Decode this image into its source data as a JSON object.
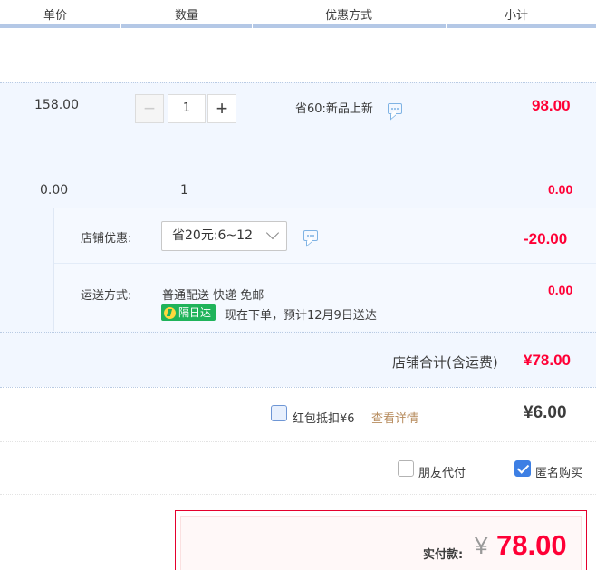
{
  "header": {
    "col_price": "单价",
    "col_qty": "数量",
    "col_discount": "优惠方式",
    "col_subtotal": "小计"
  },
  "item1": {
    "price": "158.00",
    "qty": "1",
    "discount": "省60:新品上新",
    "subtotal": "98.00"
  },
  "item2": {
    "price": "0.00",
    "qty": "1",
    "subtotal": "0.00"
  },
  "shop_discount": {
    "label": "店铺优惠:",
    "selected": "省20元:6~12",
    "amount": "-20.00"
  },
  "shipping": {
    "label": "运送方式:",
    "method": "普通配送 快递 免邮",
    "badge": "隔日达",
    "eta": "现在下单，预计12月9日送达",
    "amount": "0.00"
  },
  "shop_total": {
    "label": "店铺合计(含运费)",
    "amount": "¥78.00"
  },
  "red_packet": {
    "label": "红包抵扣¥6",
    "link": "查看详情",
    "amount": "¥6.00"
  },
  "options": {
    "friend_pay": "朋友代付",
    "anonymous": "匿名购买",
    "anonymous_checked": true
  },
  "payment": {
    "label": "实付款:",
    "currency": "¥",
    "amount": "78.00"
  },
  "colors": {
    "accent_red": "#ff0036",
    "band_blue": "#f2f7ff",
    "header_line": "#b4c8e6",
    "badge_green": "#1fb35a"
  }
}
